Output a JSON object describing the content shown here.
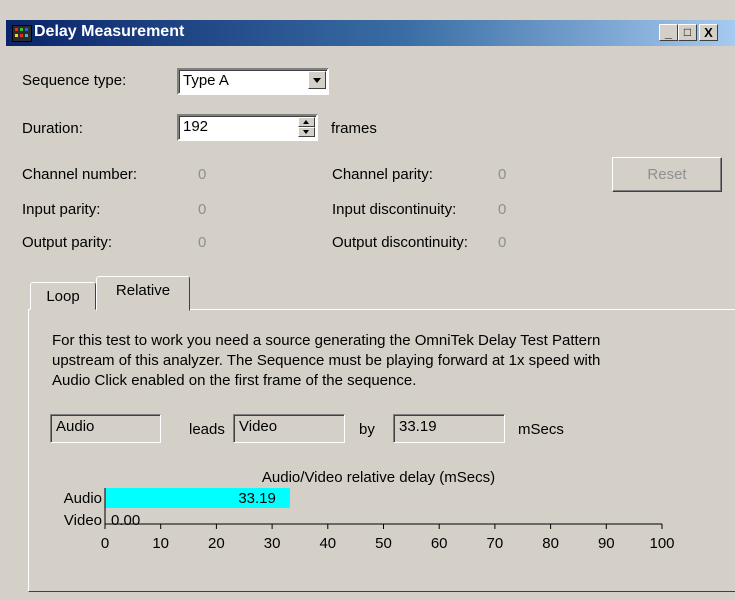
{
  "window": {
    "title": "Delay Measurement",
    "controls": {
      "minimize": "_",
      "maximize": "□",
      "close": "X"
    }
  },
  "form": {
    "sequence_type_label": "Sequence type:",
    "sequence_type_value": "Type A",
    "duration_label": "Duration:",
    "duration_value": "192",
    "duration_unit": "frames"
  },
  "stats": {
    "channel_number_label": "Channel number:",
    "channel_number_value": "0",
    "input_parity_label": "Input parity:",
    "input_parity_value": "0",
    "output_parity_label": "Output parity:",
    "output_parity_value": "0",
    "channel_parity_label": "Channel parity:",
    "channel_parity_value": "0",
    "input_discontinuity_label": "Input discontinuity:",
    "input_discontinuity_value": "0",
    "output_discontinuity_label": "Output discontinuity:",
    "output_discontinuity_value": "0",
    "reset_label": "Reset"
  },
  "tabs": [
    {
      "label": "Loop",
      "active": false
    },
    {
      "label": "Relative",
      "active": true
    }
  ],
  "relative": {
    "description_lines": [
      "For this test to work you need a source generating the OmniTek Delay Test Pattern",
      "upstream of this analyzer. The Sequence must be playing forward at 1x speed with",
      "Audio Click enabled on the first frame of the sequence."
    ],
    "leader_value": "Audio",
    "leads_label": "leads",
    "follower_value": "Video",
    "by_label": "by",
    "delay_value": "33.19",
    "unit_label": "mSecs"
  },
  "chart_data": {
    "type": "bar",
    "orientation": "horizontal",
    "title": "Audio/Video relative delay (mSecs)",
    "categories": [
      "Audio",
      "Video"
    ],
    "values": [
      33.19,
      0.0
    ],
    "value_labels": [
      "33.19",
      "0.00"
    ],
    "xlim": [
      0,
      100
    ],
    "x_ticks": [
      0,
      10,
      20,
      30,
      40,
      50,
      60,
      70,
      80,
      90,
      100
    ],
    "bar_color": "#00ffff",
    "grid": false
  }
}
